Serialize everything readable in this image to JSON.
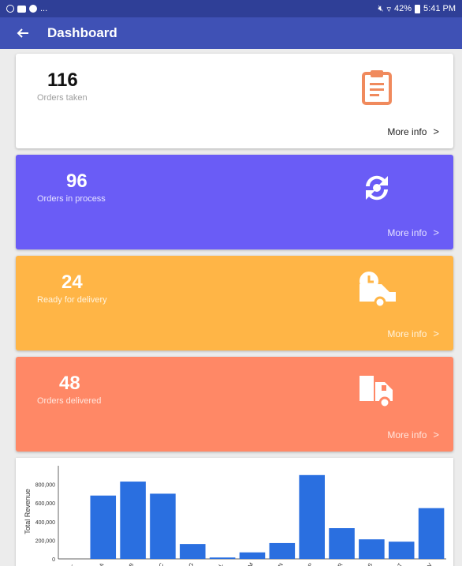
{
  "statusbar": {
    "left_text": "...",
    "battery": "42%",
    "time": "5:41 PM"
  },
  "appbar": {
    "title": "Dashboard"
  },
  "cards": [
    {
      "value": "116",
      "label": "Orders taken",
      "more": "More info",
      "bg": "#ffffff",
      "value_color": "#111111",
      "label_color": "#9e9e9e",
      "more_color": "#222222",
      "icon": "clipboard-icon",
      "icon_color": "#f08a5d"
    },
    {
      "value": "96",
      "label": "Orders in process",
      "more": "More info",
      "bg": "#6a5cf6",
      "value_color": "#ffffff",
      "label_color": "#e6e3ff",
      "more_color": "#e6e3ff",
      "icon": "sync-icon",
      "icon_color": "#ffffff"
    },
    {
      "value": "24",
      "label": "Ready for delivery",
      "more": "More info",
      "bg": "#ffb546",
      "value_color": "#ffffff",
      "label_color": "#fff3de",
      "more_color": "#fff3de",
      "icon": "delivery-clock-icon",
      "icon_color": "#ffffff"
    },
    {
      "value": "48",
      "label": "Orders delivered",
      "more": "More info",
      "bg": "#ff8866",
      "value_color": "#ffffff",
      "label_color": "#ffe6de",
      "more_color": "#ffe6de",
      "icon": "truck-icon",
      "icon_color": "#ffffff"
    }
  ],
  "chart_data": {
    "type": "bar",
    "ylabel": "Total Revenue",
    "xlabel": "",
    "ylim": [
      0,
      1000000
    ],
    "yticks": [
      "0",
      "200,000",
      "400,000",
      "600,000",
      "800,000"
    ],
    "categories": [
      "-",
      "A",
      "B",
      "C",
      "G",
      "L",
      "M",
      "N",
      "P",
      "R",
      "S",
      "T",
      "V"
    ],
    "values": [
      0,
      680000,
      830000,
      700000,
      160000,
      15000,
      70000,
      170000,
      900000,
      330000,
      210000,
      185000,
      545000
    ],
    "color": "#2a6fe0",
    "grid": false
  }
}
